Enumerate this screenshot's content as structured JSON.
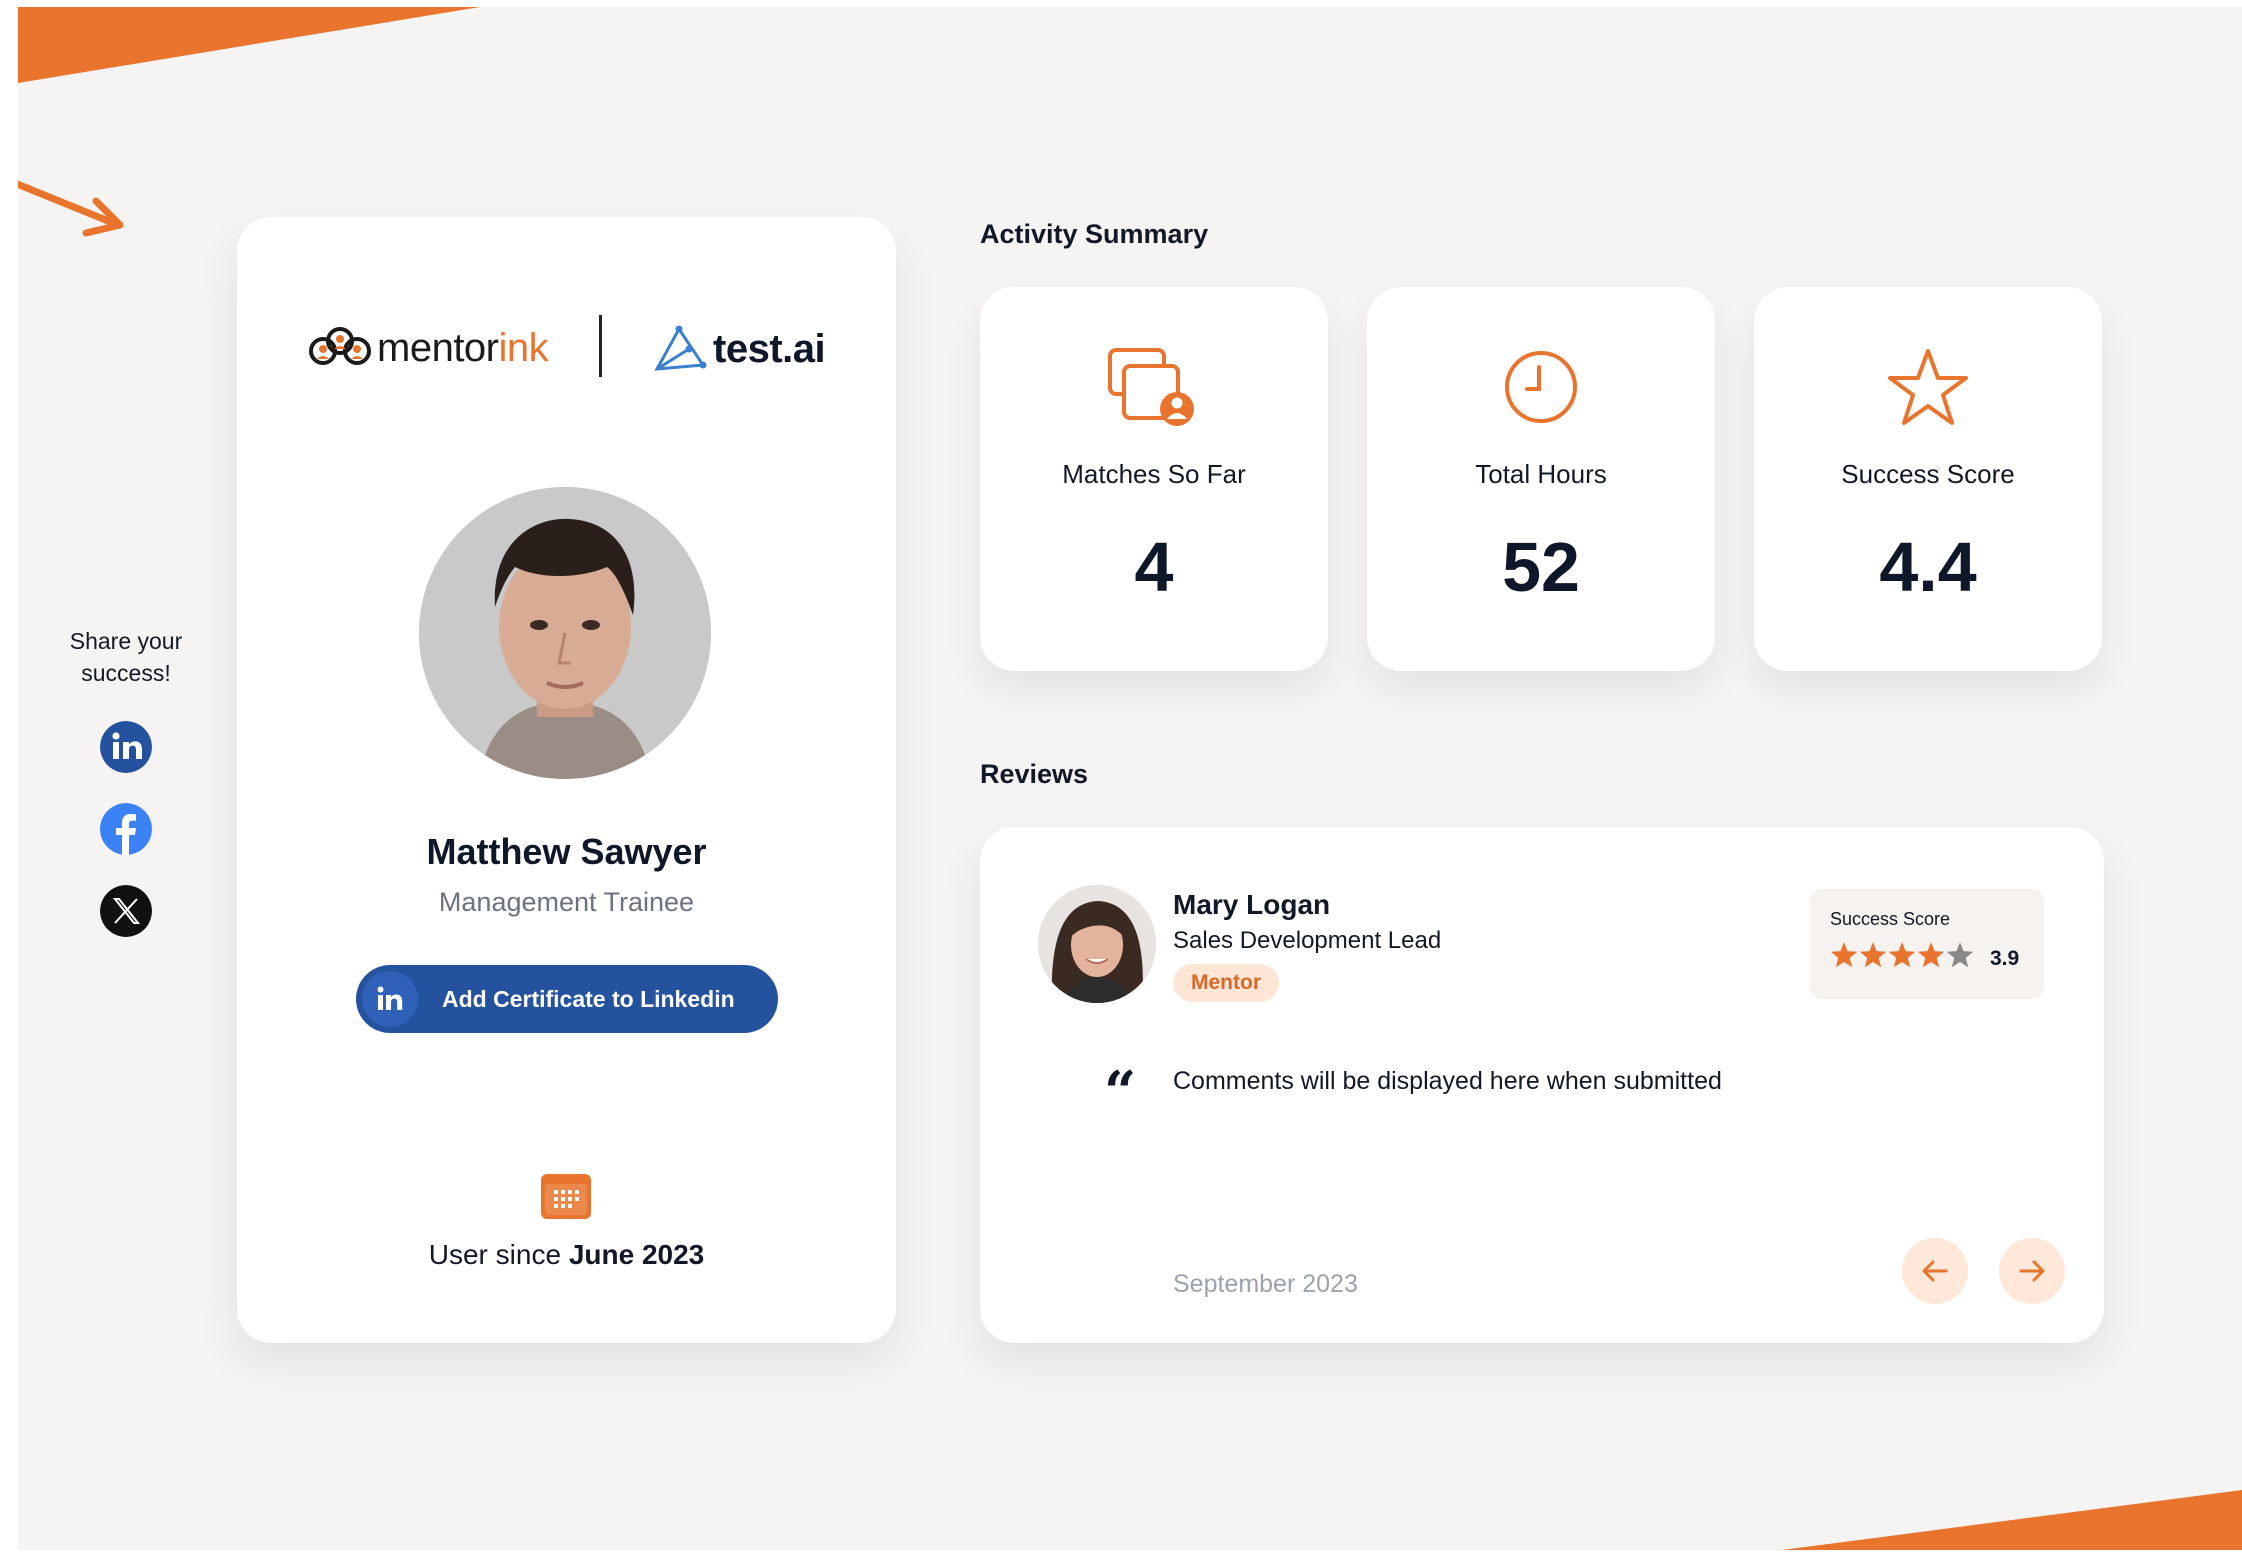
{
  "colors": {
    "accent": "#e8742d",
    "linkedin": "#24529f",
    "background": "#f5f4f2"
  },
  "share": {
    "title_line1": "Share your",
    "title_line2": "success!",
    "icons": [
      "linkedin-icon",
      "facebook-icon",
      "x-icon"
    ]
  },
  "profile": {
    "brand_left": "mentor",
    "brand_left_accent": "ink",
    "brand_right": "test.ai",
    "name": "Matthew Sawyer",
    "role": "Management Trainee",
    "cert_button": "Add Certificate to Linkedin",
    "since_prefix": "User since",
    "since_date": "June 2023"
  },
  "activity": {
    "title": "Activity Summary",
    "stats": [
      {
        "label": "Matches So Far",
        "value": "4",
        "icon": "matches-icon"
      },
      {
        "label": "Total Hours",
        "value": "52",
        "icon": "clock-icon"
      },
      {
        "label": "Success Score",
        "value": "4.4",
        "icon": "star-icon"
      }
    ]
  },
  "reviews": {
    "title": "Reviews",
    "current": {
      "name": "Mary Logan",
      "title": "Sales Development Lead",
      "badge": "Mentor",
      "score_label": "Success Score",
      "score": "3.9",
      "rating": 3.9,
      "quote_mark": "“",
      "comment": "Comments will be displayed here when submitted",
      "date": "September 2023"
    }
  }
}
